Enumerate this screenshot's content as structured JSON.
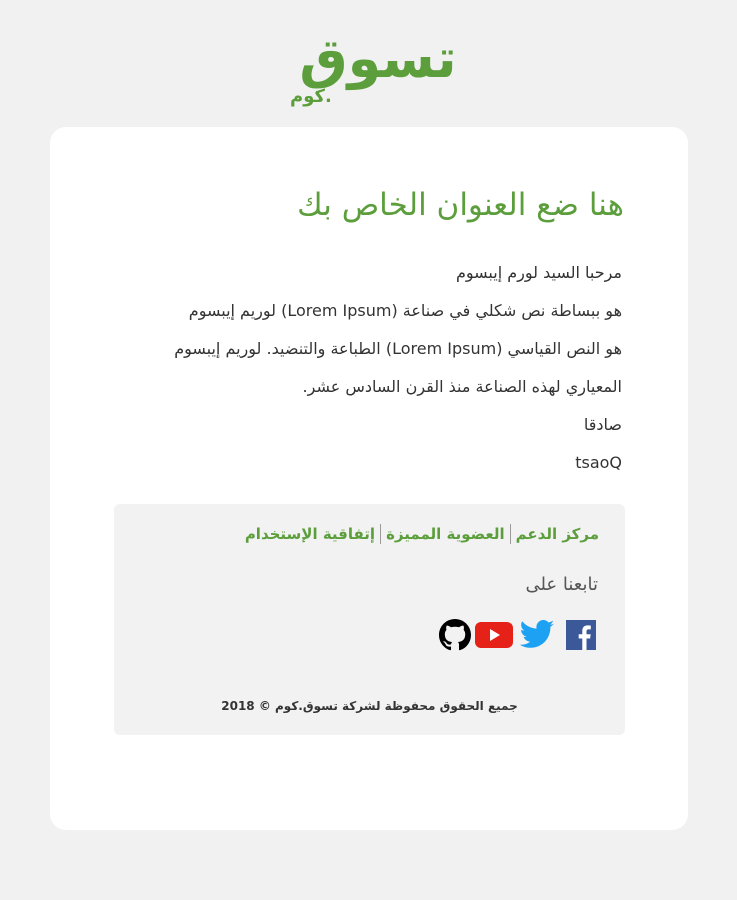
{
  "logo": {
    "main": "تسوق",
    "sub": "كوم."
  },
  "email": {
    "title": "هنا ضع العنوان الخاص بك",
    "greeting": "مرحبا السيد لورم إيبسوم",
    "line1": "هو ببساطة نص شكلي في صناعة (Lorem Ipsum) لوريم إيبسوم",
    "line2": "هو النص القياسي (Lorem Ipsum) الطباعة والتنضيد. لوريم إيبسوم",
    "line3": "المعياري لهذه الصناعة منذ القرن السادس عشر.",
    "signoff": "صادقا",
    "signature": "tsaoQ"
  },
  "footer": {
    "links": [
      "مركز الدعم",
      "العضوية المميزة",
      "إتفاقية الإستخدام"
    ],
    "follow_label": "تابعنا على",
    "social": [
      "facebook-icon",
      "twitter-icon",
      "youtube-icon",
      "github-icon"
    ],
    "copyright": "جميع الحقوق محفوظة لشركة تسوق.كوم © 2018"
  },
  "colors": {
    "brand": "#5c9e3c",
    "background": "#f1f1f1",
    "card": "#ffffff",
    "footer": "#f2f2f2",
    "facebook": "#3b5998",
    "twitter": "#1da1f2",
    "youtube": "#e62117",
    "github": "#000000"
  }
}
